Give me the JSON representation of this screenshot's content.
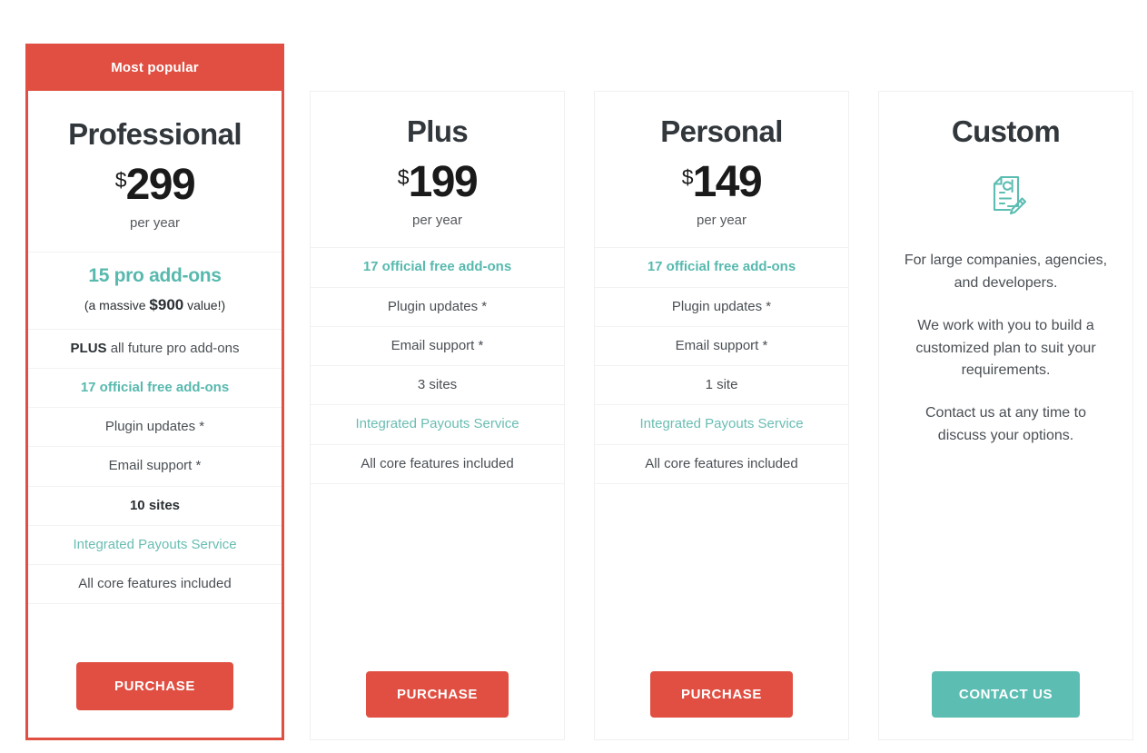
{
  "colors": {
    "accent_red": "#e04f42",
    "accent_teal": "#57b9ae",
    "link_teal": "#69bdb3",
    "border": "#f0f0f1",
    "text": "#4a4f54"
  },
  "plans": [
    {
      "id": "professional",
      "badge": "Most popular",
      "name": "Professional",
      "currency": "$",
      "amount": "299",
      "period": "per year",
      "features": [
        {
          "type": "headline",
          "main": "15 pro add-ons",
          "sub_pre": "(a massive ",
          "sub_strong": "$900",
          "sub_post": " value!)"
        },
        {
          "type": "mixed",
          "strong": "PLUS",
          "rest": " all future pro add-ons"
        },
        {
          "type": "accent",
          "text": "17 official free add-ons"
        },
        {
          "type": "plain",
          "text": "Plugin updates *"
        },
        {
          "type": "plain",
          "text": "Email support *"
        },
        {
          "type": "strong",
          "text": "10 sites"
        },
        {
          "type": "link",
          "text": "Integrated Payouts Service"
        },
        {
          "type": "plain",
          "text": "All core features included"
        }
      ],
      "cta": {
        "label": "PURCHASE",
        "style": "purchase"
      }
    },
    {
      "id": "plus",
      "name": "Plus",
      "currency": "$",
      "amount": "199",
      "period": "per year",
      "features": [
        {
          "type": "accent",
          "text": "17 official free add-ons"
        },
        {
          "type": "plain",
          "text": "Plugin updates *"
        },
        {
          "type": "plain",
          "text": "Email support *"
        },
        {
          "type": "plain",
          "text": "3 sites"
        },
        {
          "type": "link",
          "text": "Integrated Payouts Service"
        },
        {
          "type": "plain",
          "text": "All core features included"
        }
      ],
      "cta": {
        "label": "PURCHASE",
        "style": "purchase"
      }
    },
    {
      "id": "personal",
      "name": "Personal",
      "currency": "$",
      "amount": "149",
      "period": "per year",
      "features": [
        {
          "type": "accent",
          "text": "17 official free add-ons"
        },
        {
          "type": "plain",
          "text": "Plugin updates *"
        },
        {
          "type": "plain",
          "text": "Email support *"
        },
        {
          "type": "plain",
          "text": "1 site"
        },
        {
          "type": "link",
          "text": "Integrated Payouts Service"
        },
        {
          "type": "plain",
          "text": "All core features included"
        }
      ],
      "cta": {
        "label": "PURCHASE",
        "style": "purchase"
      }
    },
    {
      "id": "custom",
      "name": "Custom",
      "icon": "invoice-edit-icon",
      "paragraphs": [
        "For large companies, agencies, and developers.",
        "We work with you to build a customized plan to suit your requirements.",
        "Contact us at any time to discuss your options."
      ],
      "cta": {
        "label": "CONTACT US",
        "style": "contact"
      }
    }
  ]
}
